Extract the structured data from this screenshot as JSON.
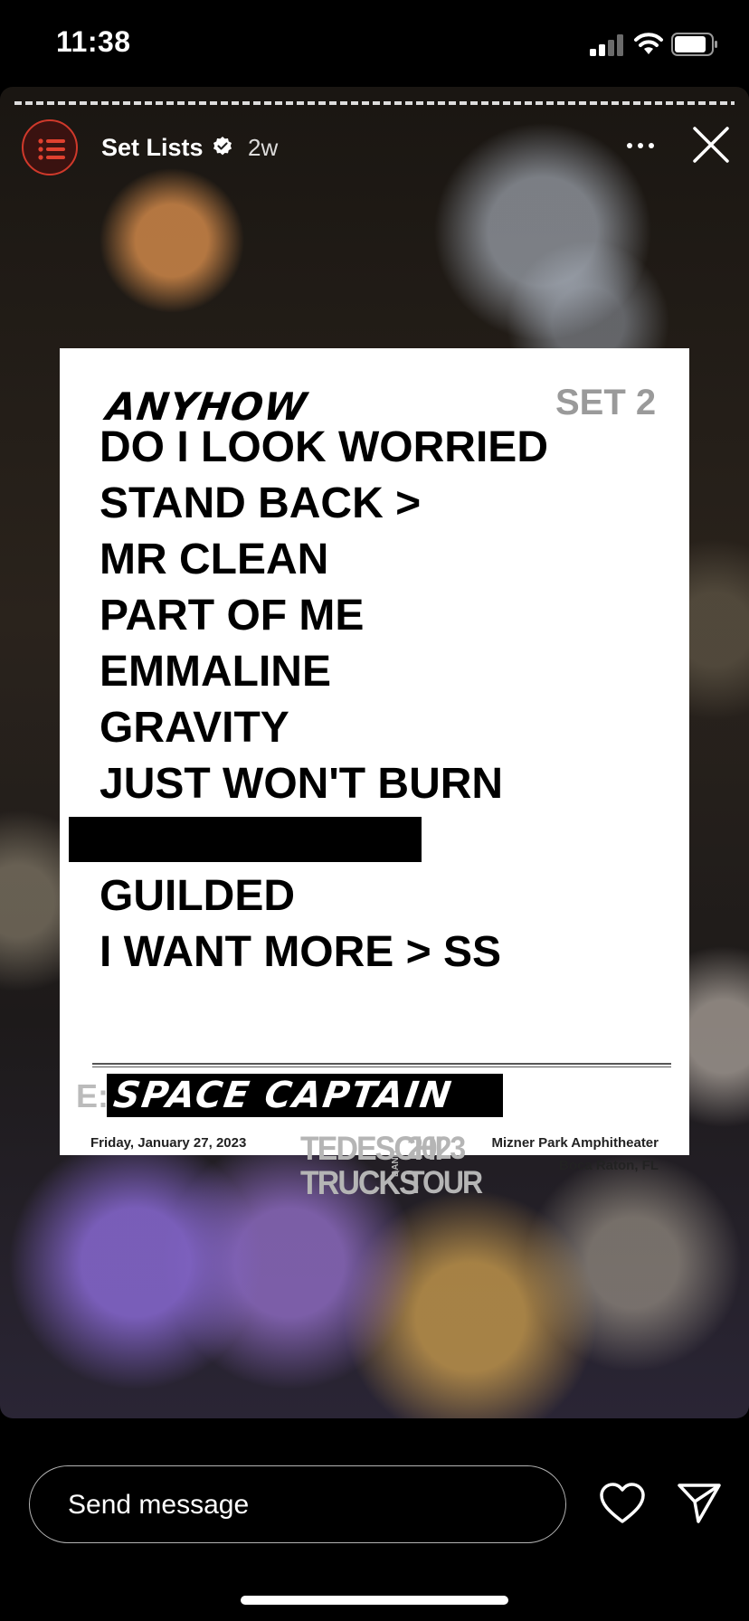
{
  "status_bar": {
    "time": "11:38",
    "icons": [
      "signal-icon",
      "wifi-icon",
      "battery-icon"
    ]
  },
  "story": {
    "account": "Set Lists",
    "verified": true,
    "posted_ago": "2w",
    "icons": [
      "menu-list-icon",
      "verified-badge-icon",
      "more-icon",
      "close-icon"
    ]
  },
  "setlist": {
    "opener": "ANYHOW",
    "set_label": "SET 2",
    "songs": [
      "DO I LOOK WORRIED",
      "STAND BACK >",
      "MR CLEAN",
      "PART OF ME",
      "EMMALINE",
      "GRAVITY",
      "JUST WON'T BURN",
      "",
      "GUILDED",
      "I WANT MORE > SS"
    ],
    "encore_prefix": "E:",
    "encore": "SPACE CAPTAIN",
    "date": "Friday, January 27, 2023",
    "venue": "Mizner Park Amphitheater",
    "city": "Boca Raton, FL",
    "logo": {
      "line1": "TEDESCHI",
      "line2": "TRUCKS",
      "band": "BAND",
      "year": "2023",
      "tour": "TOUR"
    }
  },
  "reply": {
    "placeholder": "Send message",
    "icons": [
      "heart-icon",
      "send-icon"
    ]
  },
  "colors": {
    "avatar_accent": "#d0392b",
    "background": "#000000"
  }
}
